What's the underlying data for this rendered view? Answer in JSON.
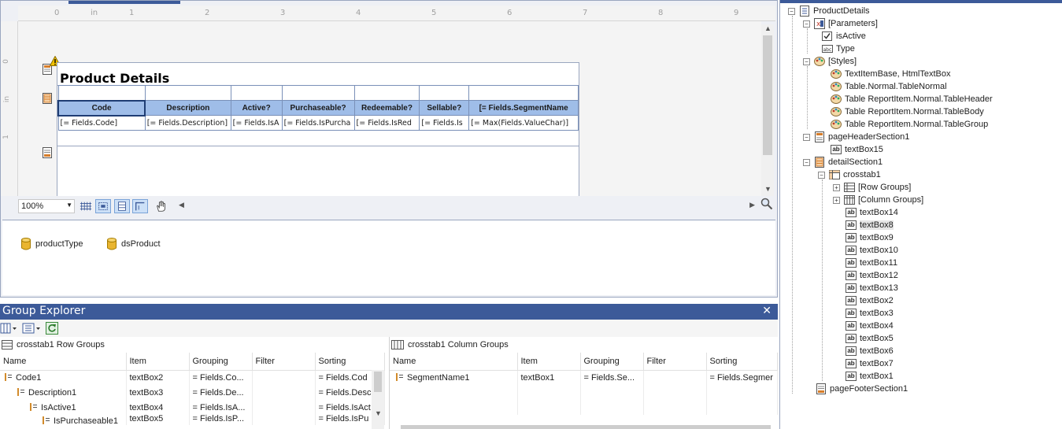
{
  "designer": {
    "ruler_h": [
      "0",
      "in",
      "1",
      "2",
      "3",
      "4",
      "5",
      "6",
      "7",
      "8",
      "9"
    ],
    "ruler_v": [
      "0",
      "in",
      "1"
    ],
    "report_title": "Product Details",
    "crosstab": {
      "headers": [
        "Code",
        "Description",
        "Active?",
        "Purchaseable?",
        "Redeemable?",
        "Sellable?",
        "[= Fields.SegmentName"
      ],
      "cells": [
        "[= Fields.Code]",
        "[= Fields.Description]",
        "[= Fields.IsA",
        "[= Fields.IsPurcha",
        "[= Fields.IsRed",
        "[= Fields.Is",
        "[= Max(Fields.ValueChar)]"
      ]
    },
    "zoom": "100%"
  },
  "data_sources": [
    "productType",
    "dsProduct"
  ],
  "group_explorer": {
    "title": "Group Explorer",
    "row_groups": {
      "title": "crosstab1 Row Groups",
      "columns": [
        "Name",
        "Item",
        "Grouping",
        "Filter",
        "Sorting"
      ],
      "rows": [
        {
          "name": "Code1",
          "item": "textBox2",
          "grouping": "= Fields.Co...",
          "filter": "",
          "sorting": "= Fields.Cod"
        },
        {
          "name": "Description1",
          "item": "textBox3",
          "grouping": "= Fields.De...",
          "filter": "",
          "sorting": "= Fields.Desc"
        },
        {
          "name": "IsActive1",
          "item": "textBox4",
          "grouping": "= Fields.IsA...",
          "filter": "",
          "sorting": "= Fields.IsAct"
        },
        {
          "name": "IsPurchaseable1",
          "item": "textBox5",
          "grouping": "= Fields.IsP...",
          "filter": "",
          "sorting": "= Fields.IsPu"
        }
      ]
    },
    "column_groups": {
      "title": "crosstab1 Column Groups",
      "columns": [
        "Name",
        "Item",
        "Grouping",
        "Filter",
        "Sorting"
      ],
      "rows": [
        {
          "name": "SegmentName1",
          "item": "textBox1",
          "grouping": "= Fields.Se...",
          "filter": "",
          "sorting": "= Fields.Segmer"
        }
      ]
    }
  },
  "tree": {
    "root": "ProductDetails",
    "parameters": "[Parameters]",
    "params": [
      "isActive",
      "Type"
    ],
    "styles": "[Styles]",
    "style_items": [
      "TextItemBase, HtmlTextBox",
      "Table.Normal.TableNormal",
      "Table ReportItem.Normal.TableHeader",
      "Table ReportItem.Normal.TableBody",
      "Table ReportItem.Normal.TableGroup"
    ],
    "page_header": "pageHeaderSection1",
    "page_header_items": [
      "textBox15"
    ],
    "detail": "detailSection1",
    "crosstab": "crosstab1",
    "row_groups": "[Row Groups]",
    "column_groups": "[Column Groups]",
    "textboxes": [
      "textBox14",
      "textBox8",
      "textBox9",
      "textBox10",
      "textBox11",
      "textBox12",
      "textBox13",
      "textBox2",
      "textBox3",
      "textBox4",
      "textBox5",
      "textBox6",
      "textBox7",
      "textBox1"
    ],
    "selected": "textBox8",
    "page_footer": "pageFooterSection1"
  },
  "colors": {
    "accent": "#3c5a99",
    "header_fill": "#9fbde8",
    "warning": "#f2c200"
  }
}
